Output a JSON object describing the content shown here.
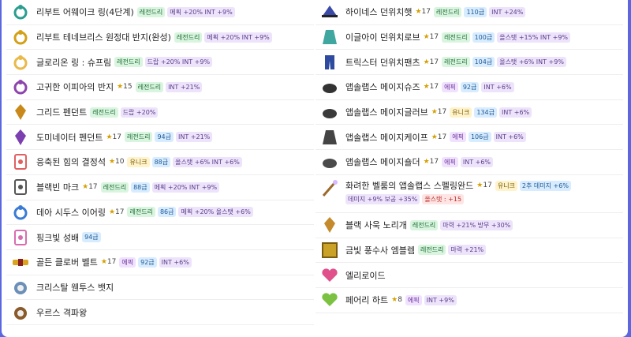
{
  "left": [
    {
      "name": "리부트 어웨이크 링(4단계)",
      "icon": "ring-icon",
      "tags": [
        {
          "t": "레전드리",
          "c": "leg"
        },
        {
          "t": "메획 +20% INT +9%",
          "c": "stat"
        }
      ]
    },
    {
      "name": "리부트 테네브리스 원정대 반지(완성)",
      "icon": "gold-ring-icon",
      "tags": [
        {
          "t": "레전드리",
          "c": "leg"
        },
        {
          "t": "메획 +20% INT +9%",
          "c": "stat"
        }
      ]
    },
    {
      "name": "글로리온 링 : 슈프림",
      "icon": "gem-ring-icon",
      "tags": [
        {
          "t": "레전드리",
          "c": "leg"
        },
        {
          "t": "드랍 +20% INT +9%",
          "c": "stat"
        }
      ]
    },
    {
      "name": "고귀한 이피아의 반지",
      "icon": "purple-ring-icon",
      "star": "15",
      "tags": [
        {
          "t": "레전드리",
          "c": "leg"
        },
        {
          "t": "INT +21%",
          "c": "stat"
        }
      ]
    },
    {
      "name": "그리드 펜던트",
      "icon": "pendant-icon",
      "tags": [
        {
          "t": "레전드리",
          "c": "leg"
        },
        {
          "t": "드랍 +20%",
          "c": "stat"
        }
      ]
    },
    {
      "name": "도미네이터 펜던트",
      "icon": "dominator-pendant-icon",
      "star": "17",
      "tags": [
        {
          "t": "레전드리",
          "c": "leg"
        },
        {
          "t": "94급",
          "c": "lvl"
        },
        {
          "t": "INT +21%",
          "c": "stat"
        }
      ]
    },
    {
      "name": "응축된 힘의 결정석",
      "icon": "crystal-icon",
      "star": "10",
      "tags": [
        {
          "t": "유니크",
          "c": "uni"
        },
        {
          "t": "88급",
          "c": "lvl"
        },
        {
          "t": "올스탯 +6% INT +6%",
          "c": "stat"
        }
      ]
    },
    {
      "name": "블랙빈 마크",
      "icon": "mark-icon",
      "star": "17",
      "tags": [
        {
          "t": "레전드리",
          "c": "leg"
        },
        {
          "t": "88급",
          "c": "lvl"
        },
        {
          "t": "메획 +20% INT +9%",
          "c": "stat"
        }
      ]
    },
    {
      "name": "데아 시두스 이어링",
      "icon": "earring-icon",
      "star": "17",
      "tags": [
        {
          "t": "레전드리",
          "c": "leg"
        },
        {
          "t": "86급",
          "c": "lvl"
        },
        {
          "t": "메획 +20% 올스탯 +6%",
          "c": "stat"
        }
      ]
    },
    {
      "name": "핑크빛 성배",
      "icon": "grail-icon",
      "tags": [
        {
          "t": "94급",
          "c": "lvl"
        }
      ]
    },
    {
      "name": "골든 클로버 벨트",
      "icon": "belt-icon",
      "star": "17",
      "tags": [
        {
          "t": "에픽",
          "c": "epic"
        },
        {
          "t": "92급",
          "c": "lvl"
        },
        {
          "t": "INT +6%",
          "c": "stat"
        }
      ]
    },
    {
      "name": "크리스탈 웬투스 뱃지",
      "icon": "badge-icon",
      "tags": []
    },
    {
      "name": "우르스 격파왕",
      "icon": "medal-icon",
      "tags": []
    }
  ],
  "right": [
    {
      "name": "하이네스 던위치햇",
      "icon": "hat-icon",
      "star": "17",
      "tags": [
        {
          "t": "레전드리",
          "c": "leg"
        },
        {
          "t": "110급",
          "c": "lvl"
        },
        {
          "t": "INT +24%",
          "c": "stat"
        }
      ]
    },
    {
      "name": "이글아이 던위치로브",
      "icon": "robe-icon",
      "star": "17",
      "tags": [
        {
          "t": "레전드리",
          "c": "leg"
        },
        {
          "t": "100급",
          "c": "lvl"
        },
        {
          "t": "올스탯 +15% INT +9%",
          "c": "stat"
        }
      ]
    },
    {
      "name": "트릭스터 던위치팬츠",
      "icon": "pants-icon",
      "star": "17",
      "tags": [
        {
          "t": "레전드리",
          "c": "leg"
        },
        {
          "t": "104급",
          "c": "lvl"
        },
        {
          "t": "올스탯 +6% INT +9%",
          "c": "stat"
        }
      ]
    },
    {
      "name": "앱솔랩스 메이지슈즈",
      "icon": "shoes-icon",
      "star": "17",
      "tags": [
        {
          "t": "에픽",
          "c": "epic"
        },
        {
          "t": "92급",
          "c": "lvl"
        },
        {
          "t": "INT +6%",
          "c": "stat"
        }
      ]
    },
    {
      "name": "앱솔랩스 메이지글러브",
      "icon": "glove-icon",
      "star": "17",
      "tags": [
        {
          "t": "유니크",
          "c": "uni"
        },
        {
          "t": "134급",
          "c": "lvl"
        },
        {
          "t": "INT +6%",
          "c": "stat"
        }
      ]
    },
    {
      "name": "앱솔랩스 메이지케이프",
      "icon": "cape-icon",
      "star": "17",
      "tags": [
        {
          "t": "에픽",
          "c": "epic"
        },
        {
          "t": "106급",
          "c": "lvl"
        },
        {
          "t": "INT +6%",
          "c": "stat"
        }
      ]
    },
    {
      "name": "앱솔랩스 메이지숄더",
      "icon": "shoulder-icon",
      "star": "17",
      "tags": [
        {
          "t": "에픽",
          "c": "epic"
        },
        {
          "t": "INT +6%",
          "c": "stat"
        }
      ]
    },
    {
      "name": "화려한 벨룸의 앱솔랩스 스펠링완드",
      "icon": "wand-icon",
      "star": "17",
      "tags": [
        {
          "t": "유니크",
          "c": "uni"
        },
        {
          "t": "2추 데미지 +6%",
          "c": "lvl"
        }
      ],
      "tags2": [
        {
          "t": "데미지 +9% 보공 +35%",
          "c": "stat"
        },
        {
          "t": "올스탯 : +15",
          "c": "red"
        }
      ]
    },
    {
      "name": "블랙 사욱 노리개",
      "icon": "norigae-icon",
      "tags": [
        {
          "t": "레전드리",
          "c": "leg"
        },
        {
          "t": "마력 +21% 방무 +30%",
          "c": "stat"
        }
      ]
    },
    {
      "name": "금빛 풍수사 엠블렘",
      "icon": "emblem-icon",
      "tags": [
        {
          "t": "레전드리",
          "c": "leg"
        },
        {
          "t": "마력 +21%",
          "c": "stat"
        }
      ]
    },
    {
      "name": "엘리로이드",
      "icon": "heart-icon",
      "tags": []
    },
    {
      "name": "페어리 하트",
      "icon": "fairy-heart-icon",
      "star": "8",
      "tags": [
        {
          "t": "에픽",
          "c": "epic"
        },
        {
          "t": "INT +9%",
          "c": "stat"
        }
      ]
    }
  ],
  "colors": {
    "ring-icon": "#2a9d8f",
    "gold-ring-icon": "#d4a017",
    "gem-ring-icon": "#e9b949",
    "purple-ring-icon": "#8e44ad",
    "pendant-icon": "#c9891a",
    "dominator-pendant-icon": "#7b3fb0",
    "crystal-icon": "#e06060",
    "mark-icon": "#555555",
    "earring-icon": "#3a7bd5",
    "grail-icon": "#d96cb0",
    "belt-icon": "#d9a520",
    "badge-icon": "#6c8fb8",
    "medal-icon": "#8a5a2b",
    "hat-icon": "#3b4aa8",
    "robe-icon": "#3fa7a0",
    "pants-icon": "#2e4ba0",
    "shoes-icon": "#333333",
    "glove-icon": "#3a3a3a",
    "cape-icon": "#444444",
    "shoulder-icon": "#4a4a4a",
    "wand-icon": "#9a6a2a",
    "norigae-icon": "#c48a2c",
    "emblem-icon": "#c9a227",
    "heart-icon": "#e0508a",
    "fairy-heart-icon": "#7cc242"
  }
}
